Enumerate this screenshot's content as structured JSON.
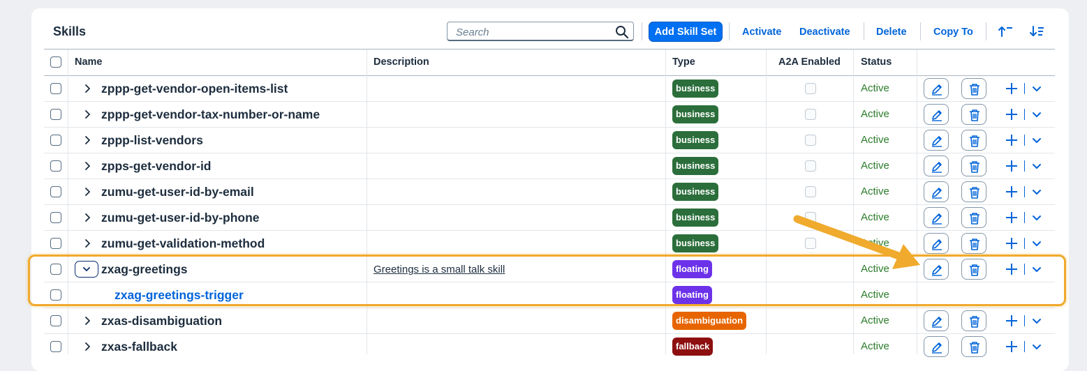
{
  "panel": {
    "title": "Skills"
  },
  "toolbar": {
    "search_placeholder": "Search",
    "add_label": "Add Skill Set",
    "activate_label": "Activate",
    "deactivate_label": "Deactivate",
    "delete_label": "Delete",
    "copy_label": "Copy To"
  },
  "columns": {
    "name": "Name",
    "description": "Description",
    "type": "Type",
    "a2a": "A2A Enabled",
    "status": "Status"
  },
  "rows": [
    {
      "name": "zppp-get-vendor-open-items-list",
      "description": "",
      "type": "business",
      "status": "Active"
    },
    {
      "name": "zppp-get-vendor-tax-number-or-name",
      "description": "",
      "type": "business",
      "status": "Active"
    },
    {
      "name": "zppp-list-vendors",
      "description": "",
      "type": "business",
      "status": "Active"
    },
    {
      "name": "zpps-get-vendor-id",
      "description": "",
      "type": "business",
      "status": "Active"
    },
    {
      "name": "zumu-get-user-id-by-email",
      "description": "",
      "type": "business",
      "status": "Active"
    },
    {
      "name": "zumu-get-user-id-by-phone",
      "description": "",
      "type": "business",
      "status": "Active"
    },
    {
      "name": "zumu-get-validation-method",
      "description": "",
      "type": "business",
      "status": "Active"
    },
    {
      "name": "zxag-greetings",
      "description": "Greetings is a small talk skill",
      "type": "floating",
      "status": "Active"
    },
    {
      "name": "zxag-greetings-trigger",
      "description": "",
      "type": "floating",
      "status": "Active"
    },
    {
      "name": "zxas-disambiguation",
      "description": "",
      "type": "disambiguation",
      "status": "Active"
    },
    {
      "name": "zxas-fallback",
      "description": "",
      "type": "fallback",
      "status": "Active"
    }
  ],
  "badge_colors": {
    "business": "#2b6e3b",
    "floating": "#6c32e9",
    "disambiguation": "#e76500",
    "fallback": "#8d0f0f"
  },
  "colors": {
    "link": "#0064d9",
    "primary": "#0070f2",
    "status_active": "#2b7c2b",
    "highlight": "#f0aa2d"
  },
  "icons": {
    "search": "search-icon",
    "sort_ascending": "sort-ascending-icon",
    "sort_descending": "sort-descending-icon",
    "expand": "chevron-right-icon",
    "collapse": "chevron-down-icon",
    "edit": "edit-icon",
    "delete": "delete-icon",
    "add": "add-icon",
    "dropdown": "dropdown-icon",
    "callout": "arrow-annotation"
  }
}
